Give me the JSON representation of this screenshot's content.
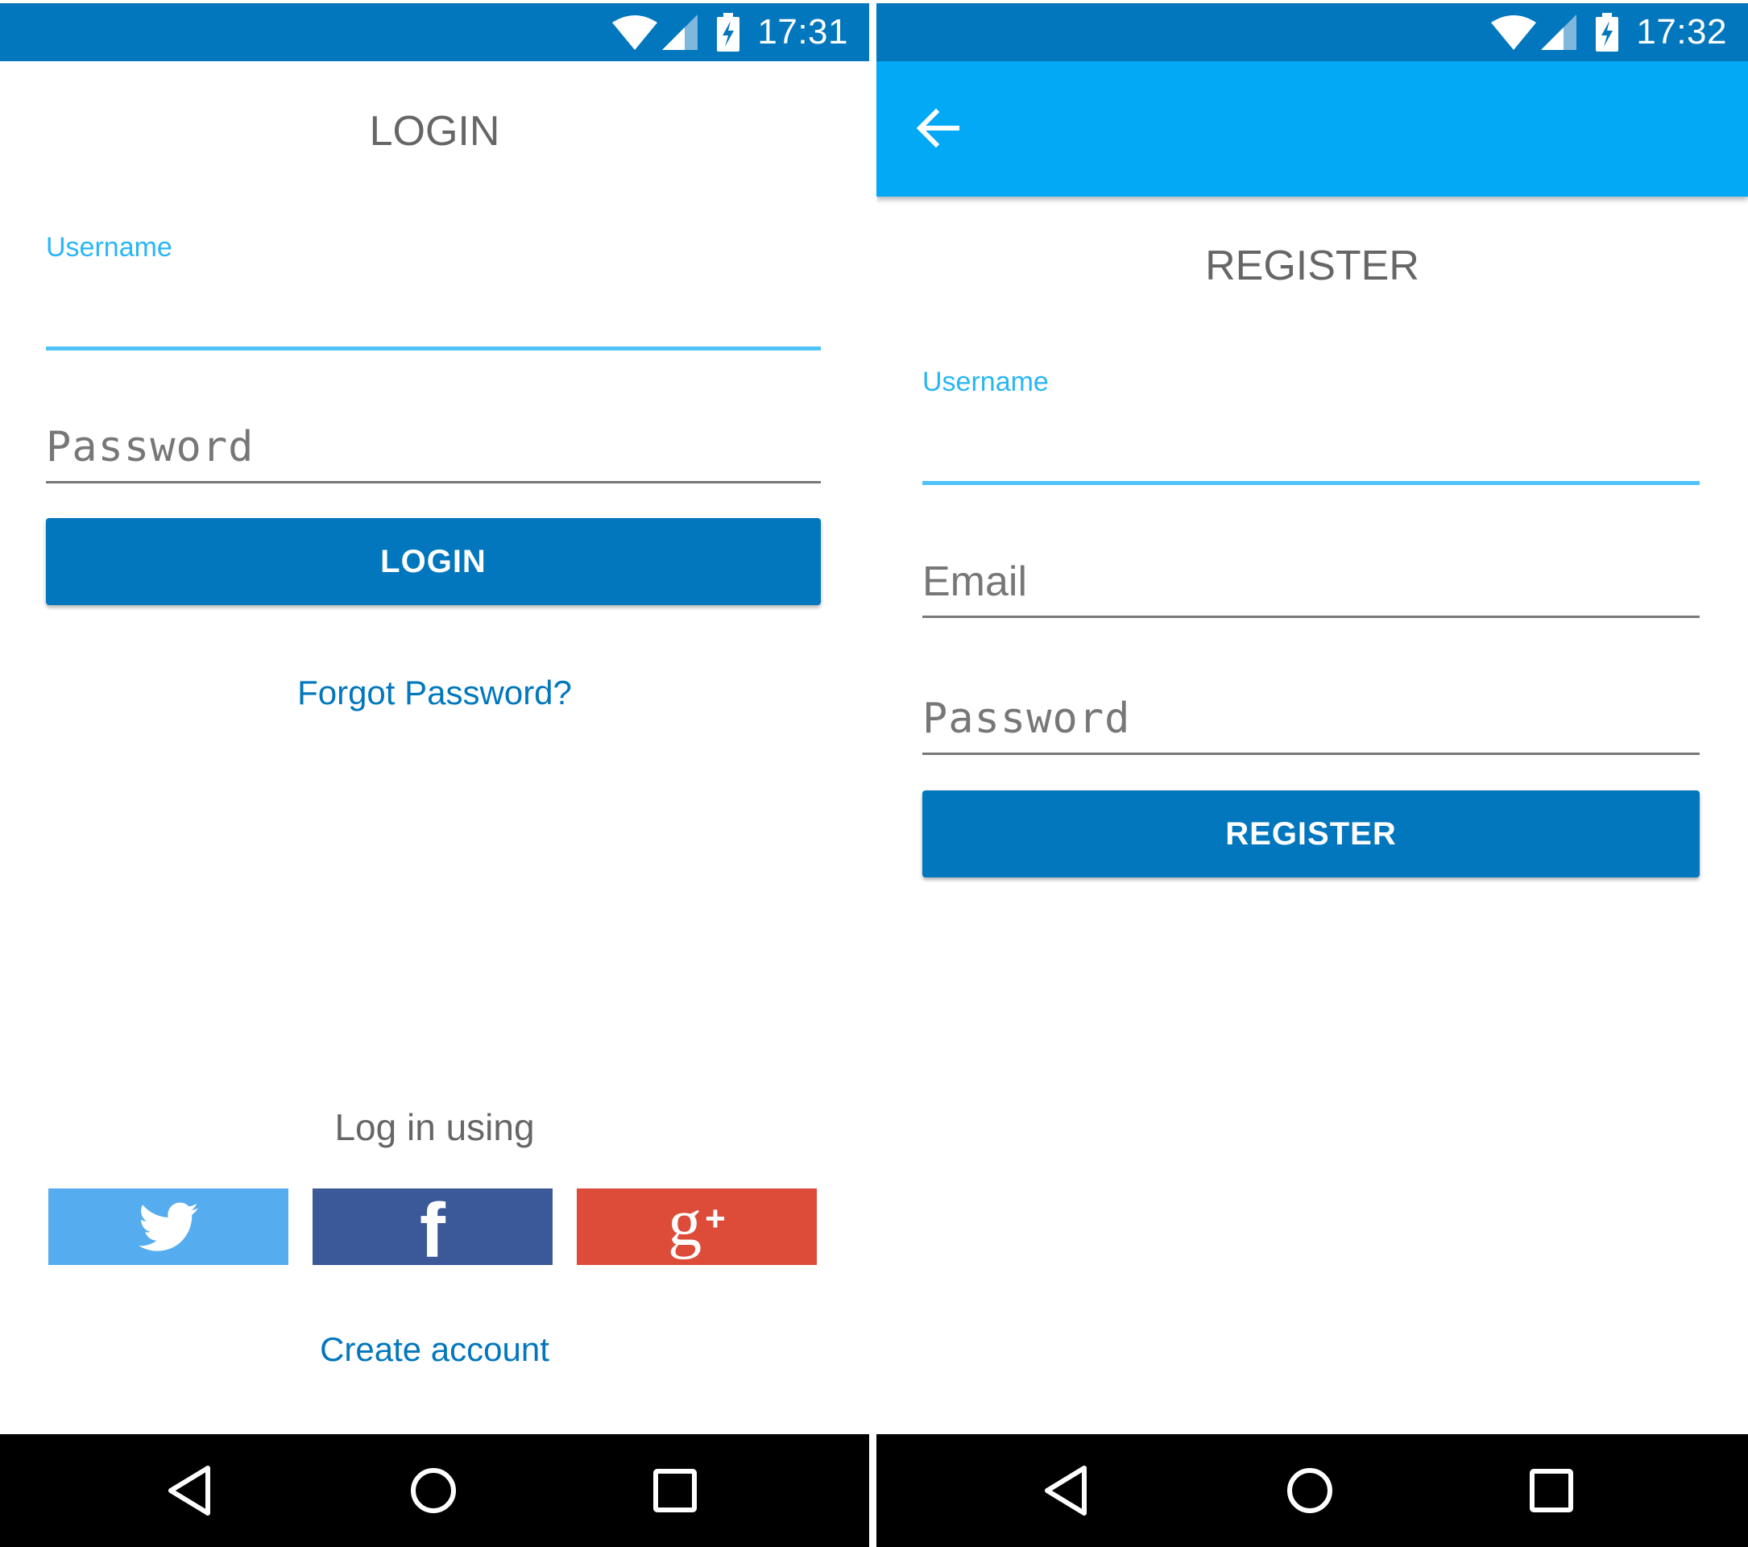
{
  "login_screen": {
    "status_time": "17:31",
    "title": "LOGIN",
    "username_label": "Username",
    "username_value": "",
    "password_placeholder": "Password",
    "login_button": "LOGIN",
    "forgot_password": "Forgot Password?",
    "social_label": "Log in using",
    "social_buttons": [
      {
        "name": "twitter",
        "icon": "twitter-bird-icon",
        "color": "#55acee"
      },
      {
        "name": "facebook",
        "icon": "facebook-f-icon",
        "glyph": "f",
        "color": "#3b5998"
      },
      {
        "name": "google-plus",
        "icon": "google-plus-icon",
        "glyph": "g",
        "glyph_plus": "+",
        "color": "#dd4b39"
      }
    ],
    "create_account": "Create account"
  },
  "register_screen": {
    "status_time": "17:32",
    "back_icon": "arrow-back-icon",
    "title": "REGISTER",
    "username_label": "Username",
    "username_value": "",
    "email_placeholder": "Email",
    "password_placeholder": "Password",
    "register_button": "REGISTER"
  },
  "status_icons": [
    "wifi-icon",
    "cell-signal-icon",
    "battery-charging-icon"
  ],
  "nav_icons": [
    "nav-back-icon",
    "nav-home-icon",
    "nav-recents-icon"
  ],
  "colors": {
    "status_bar": "#0277bd",
    "app_bar": "#03a9f4",
    "primary_button": "#0277bd",
    "field_focus": "#4fc3f7",
    "link": "#0277bd"
  }
}
